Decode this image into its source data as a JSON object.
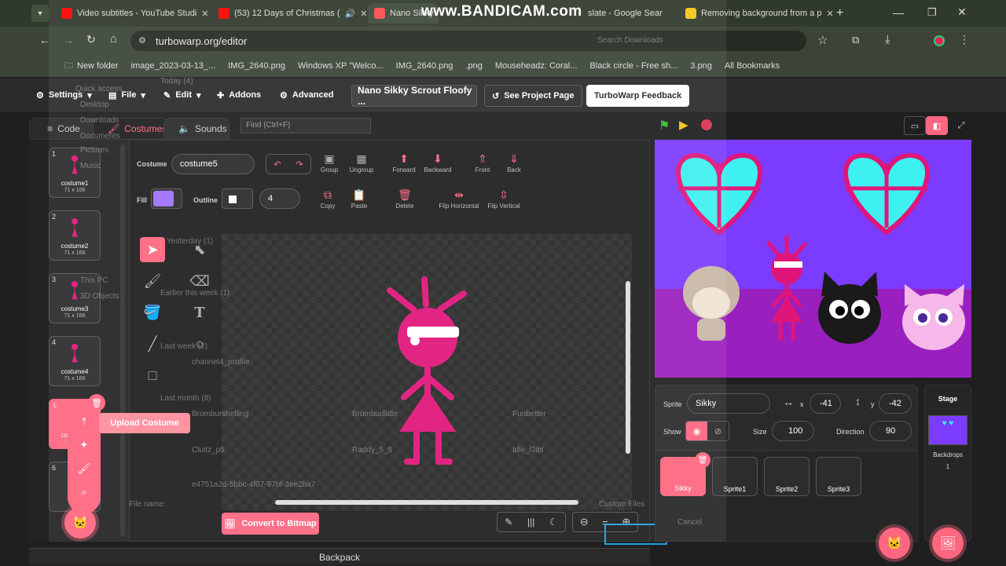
{
  "browser": {
    "watermark": "www.BANDICAM.com",
    "tabs": [
      {
        "title": "Video subtitles - YouTube Studi",
        "color": "#ff0000"
      },
      {
        "title": "(53) 12 Days of Christmas (",
        "color": "#ff0000"
      },
      {
        "title": "Nano Sikky",
        "color": "#ff4c4c"
      },
      {
        "title": "slate - Google Sear",
        "color": "#4285f4"
      },
      {
        "title": "Removing background from a p",
        "color": "#f5c518"
      }
    ],
    "url": "turbowarp.org/editor",
    "bookmarks": [
      "New folder",
      "image_2023-03-13_...",
      "IMG_2640.png",
      "Windows XP \"Welco...",
      "IMG_2640.png",
      ".png",
      "Mouseheadz: Coral...",
      "Black circle - Free sh...",
      "3.png",
      "All Bookmarks"
    ]
  },
  "menu": {
    "settings": "Settings",
    "file": "File",
    "edit": "Edit",
    "addons": "Addons",
    "advanced": "Advanced",
    "project_title": "Nano Sikky Scrout Floofy ...",
    "see_project": "See Project Page",
    "feedback": "TurboWarp Feedback"
  },
  "editor_tabs": {
    "code": "Code",
    "costumes": "Costumes",
    "sounds": "Sounds",
    "find_placeholder": "Find (Ctrl+F)"
  },
  "costumes": [
    {
      "num": "1",
      "name": "costume1",
      "size": "71 x 166"
    },
    {
      "num": "2",
      "name": "costume2",
      "size": "71 x 166"
    },
    {
      "num": "3",
      "name": "costume3",
      "size": "71 x 166"
    },
    {
      "num": "4",
      "name": "costume4",
      "size": "71 x 166"
    },
    {
      "num": "5",
      "name": "costume5",
      "size": "71 x 166"
    },
    {
      "num": "6",
      "name": "co",
      "size": ""
    }
  ],
  "paint": {
    "costume_label": "Costume",
    "costume_name": "costume5",
    "fill_label": "Fill",
    "outline_label": "Outline",
    "outline_width": "4",
    "fill_color": "#a070ff",
    "toolbar1": [
      "Group",
      "Ungroup",
      "Forward",
      "Backward",
      "Front",
      "Back"
    ],
    "toolbar2": [
      "Copy",
      "Paste",
      "Delete",
      "Flip Horizontal",
      "Flip Vertical"
    ],
    "convert": "Convert to Bitmap",
    "upload_costume": "Upload Costume"
  },
  "stage_controls": {
    "flag": "green-flag-icon",
    "pause": "pause-icon",
    "stop": "stop-icon"
  },
  "sprite_info": {
    "sprite_label": "Sprite",
    "sprite_name": "Sikky",
    "x_label": "x",
    "x": "-41",
    "y_label": "y",
    "y": "-42",
    "show_label": "Show",
    "size_label": "Size",
    "size": "100",
    "direction_label": "Direction",
    "direction": "90"
  },
  "sprites": [
    "Sikky",
    "Sprite1",
    "Sprite2",
    "Sprite3"
  ],
  "stage_pane": {
    "title": "Stage",
    "backdrops_label": "Backdrops",
    "backdrops_count": "1"
  },
  "backpack": "Backpack",
  "ghost_explorer": {
    "items": [
      "Today (4)",
      "Yesterday (1)",
      "Earlier this week (1)",
      "Last week (2)",
      "Last month (8)",
      "File name:",
      "Custom Files",
      "Cancel",
      "Search Downloads",
      "Quick access",
      "Desktop",
      "Downloads",
      "Documents",
      "Pictures",
      "Music",
      "This PC",
      "3D Objects",
      "Bromburshelling",
      "Brombudlidle",
      "Funbetter",
      "Cluitz_p5",
      "Raddy_5_5",
      "Idle_l3ibl",
      "channel4_profile",
      "e4751a2d-5bbc-4f07-97bf-3ee2ba7"
    ]
  }
}
